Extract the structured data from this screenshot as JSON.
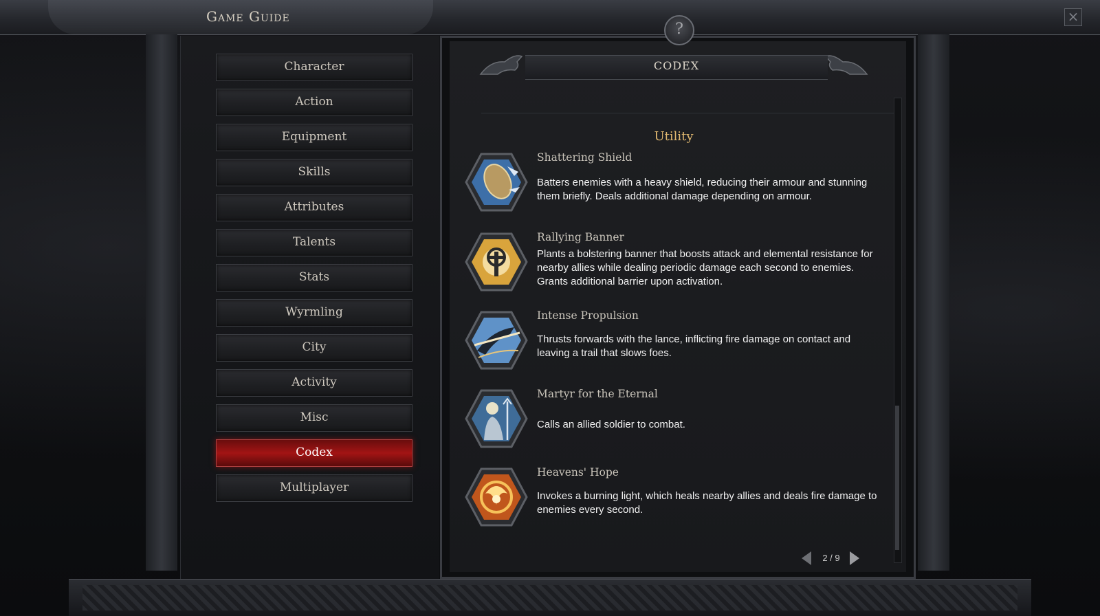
{
  "window": {
    "title": "Game Guide",
    "help_label": "?",
    "close_label": "×"
  },
  "nav": {
    "items": [
      {
        "label": "Character",
        "active": false
      },
      {
        "label": "Action",
        "active": false
      },
      {
        "label": "Equipment",
        "active": false
      },
      {
        "label": "Skills",
        "active": false
      },
      {
        "label": "Attributes",
        "active": false
      },
      {
        "label": "Talents",
        "active": false
      },
      {
        "label": "Stats",
        "active": false
      },
      {
        "label": "Wyrmling",
        "active": false
      },
      {
        "label": "City",
        "active": false
      },
      {
        "label": "Activity",
        "active": false
      },
      {
        "label": "Misc",
        "active": false
      },
      {
        "label": "Codex",
        "active": true
      },
      {
        "label": "Multiplayer",
        "active": false
      }
    ]
  },
  "codex": {
    "header": "CODEX",
    "section_title": "Utility",
    "entries": [
      {
        "name": "Shattering Shield",
        "icon": "shield-skill-icon",
        "desc_lines": [
          "Batters enemies with a heavy shield, reducing their armour and stunning",
          "them briefly. Deals additional damage depending on armour."
        ]
      },
      {
        "name": "Rallying Banner",
        "icon": "banner-skill-icon",
        "desc_lines": [
          "Plants a bolstering banner that boosts attack and elemental resistance for",
          "nearby allies while dealing periodic damage each second to enemies.",
          "Grants additional barrier upon activation."
        ]
      },
      {
        "name": "Intense Propulsion",
        "icon": "lance-charge-skill-icon",
        "desc_lines": [
          "Thrusts forwards with the lance, inflicting fire damage on contact and",
          "leaving a trail that slows foes."
        ]
      },
      {
        "name": "Martyr for the Eternal",
        "icon": "soldier-summon-skill-icon",
        "desc_lines": [
          "Calls an allied soldier to combat."
        ]
      },
      {
        "name": "Heavens' Hope",
        "icon": "burning-light-skill-icon",
        "desc_lines": [
          "Invokes a burning light, which heals nearby allies and deals fire damage to",
          "enemies every second."
        ]
      }
    ],
    "pager": {
      "text": "2 / 9",
      "current": 2,
      "total": 9
    }
  },
  "colors": {
    "active_tab": "#a31414",
    "section_title": "#e0b870",
    "text": "#f1f1f1"
  }
}
